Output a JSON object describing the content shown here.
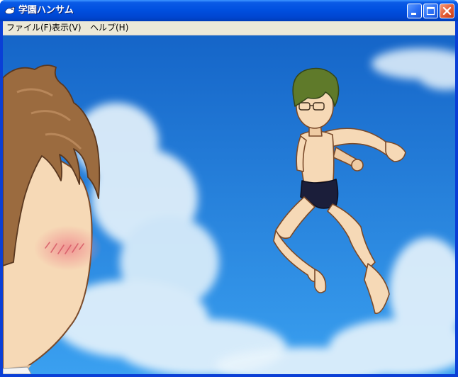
{
  "window": {
    "title": "学園ハンサム",
    "controls": {
      "minimize": "minimize-icon",
      "maximize": "maximize-icon",
      "close": "close-icon"
    }
  },
  "menu": {
    "items": [
      {
        "label": "ファイル(F)"
      },
      {
        "label": "表示(V)"
      },
      {
        "label": "ヘルプ(H)"
      }
    ]
  },
  "scene": {
    "sky_top_color": "#1565c8",
    "sky_bottom_color": "#3aa0f0",
    "cloud_color": "#e8f4fc",
    "skin_color": "#f6d9b6",
    "brown_hair_color": "#9b6b3f",
    "green_hair_color": "#5f7a2a",
    "swimsuit_color": "#1b1e3a"
  }
}
